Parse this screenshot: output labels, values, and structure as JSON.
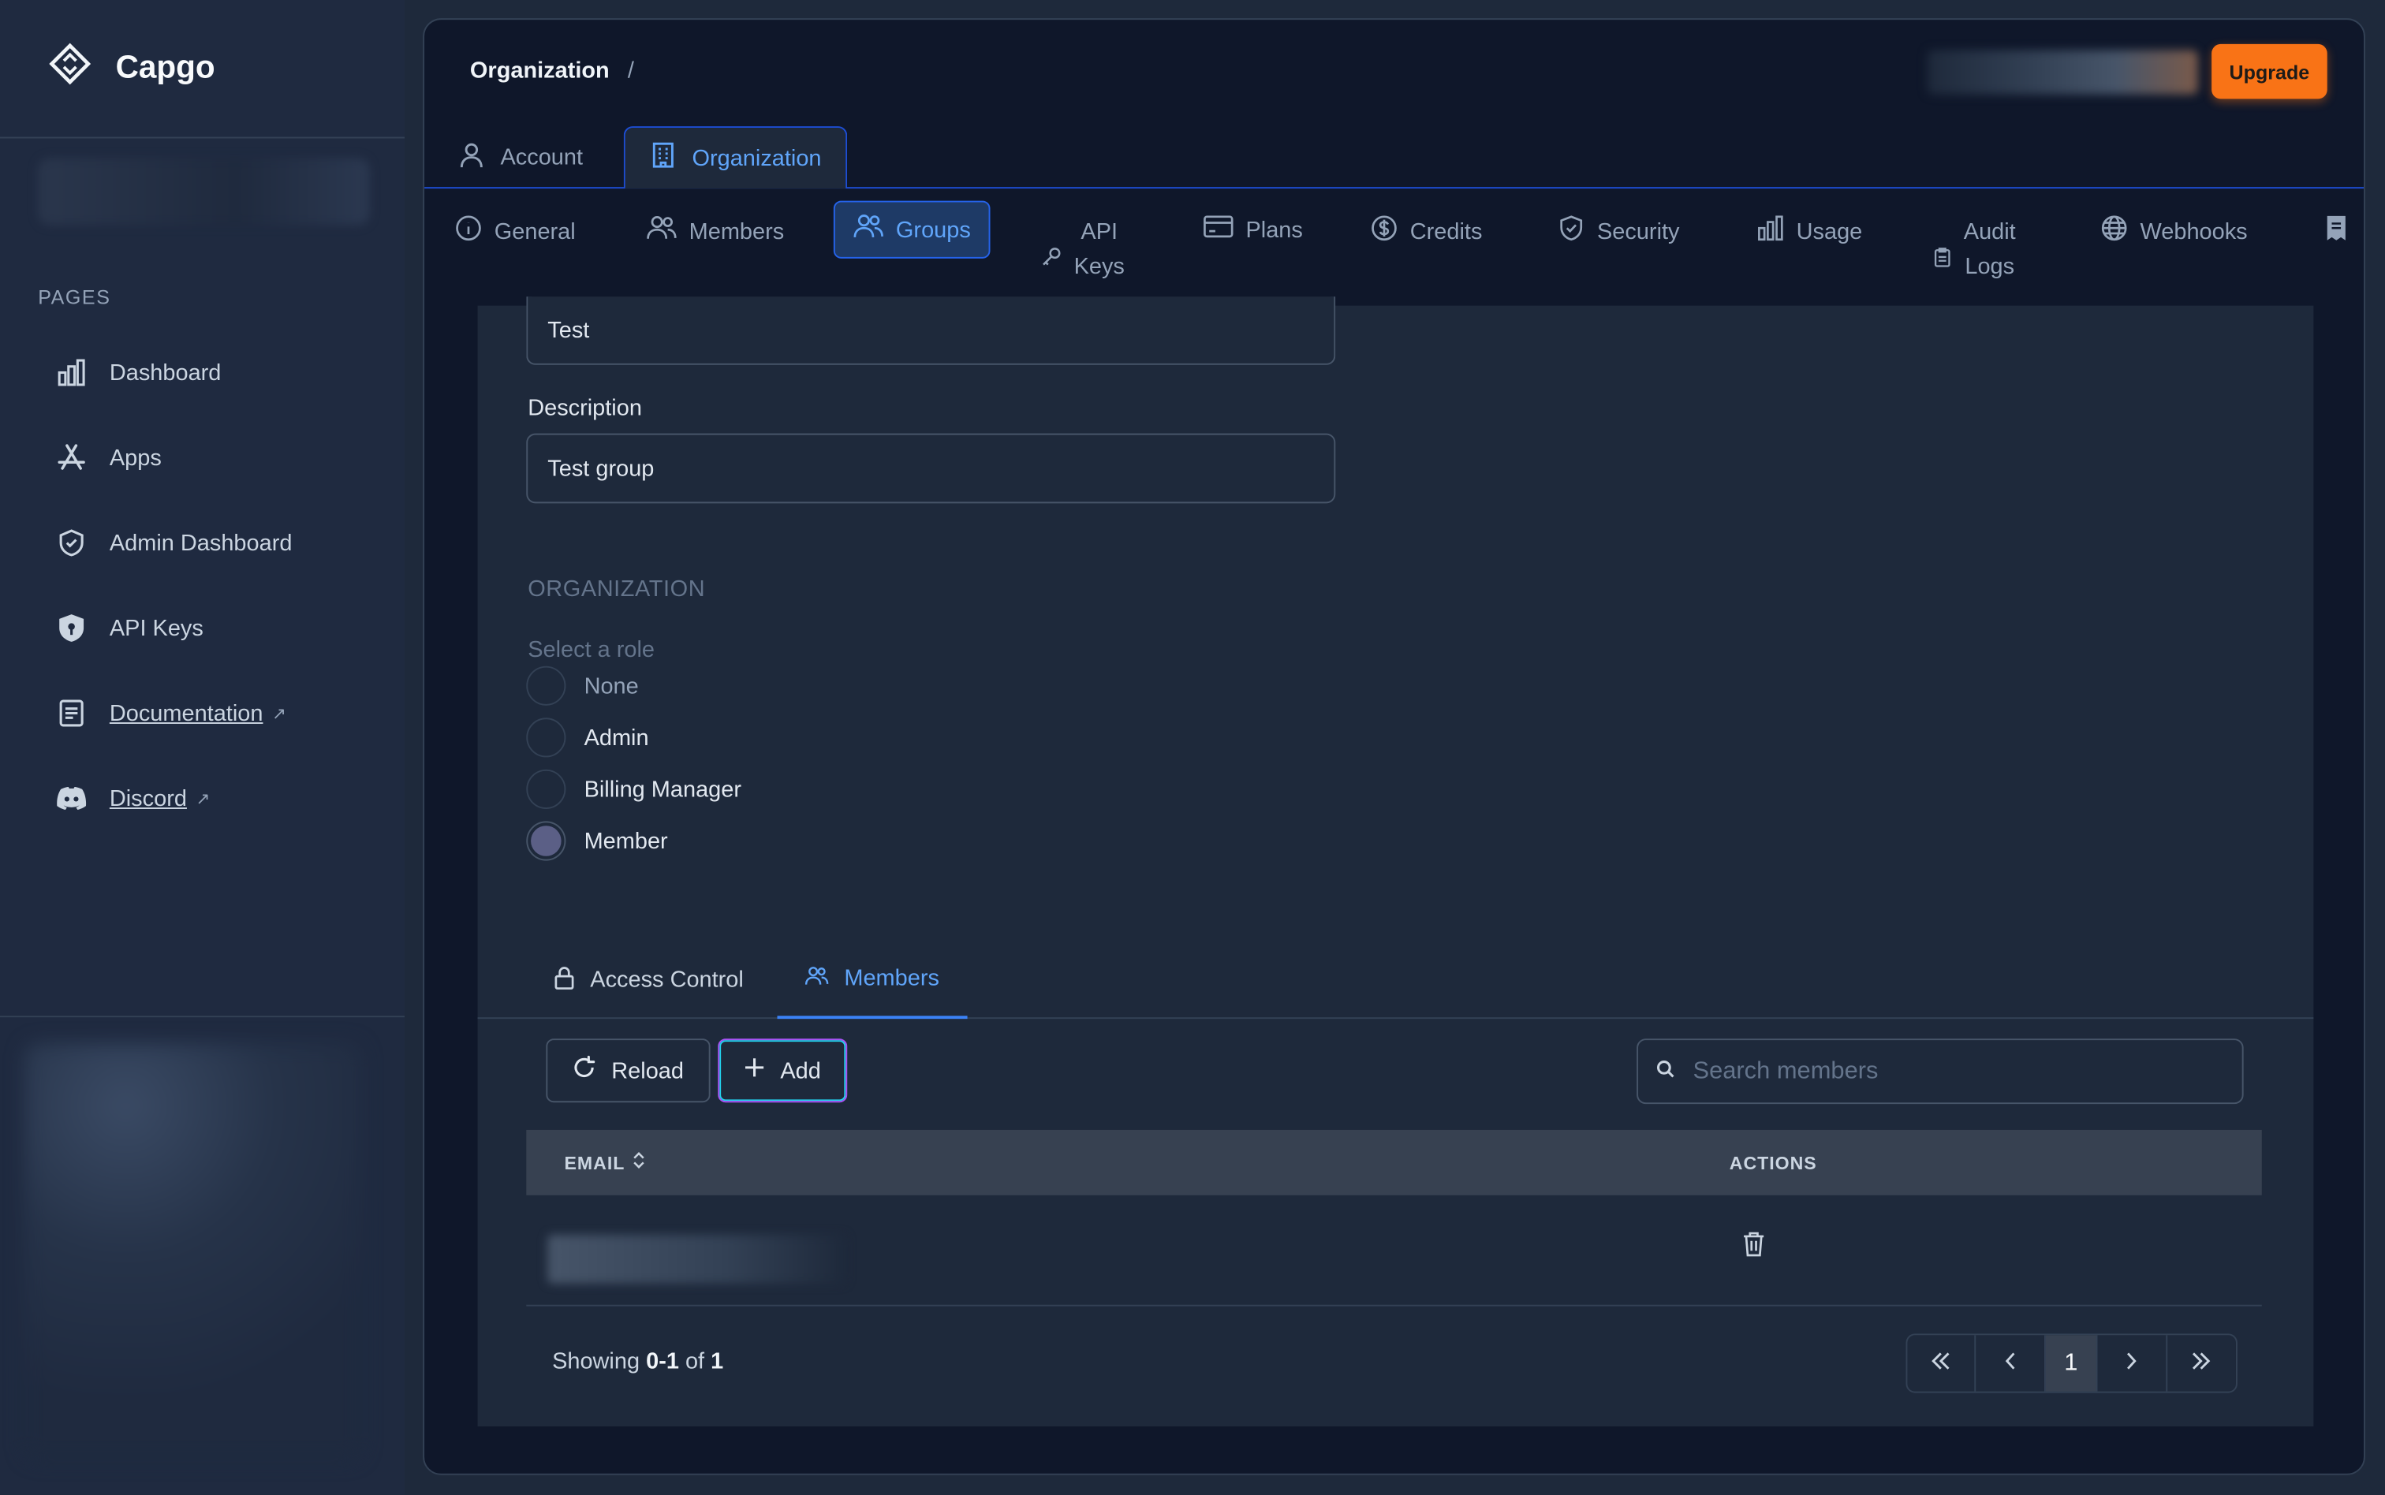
{
  "brand": {
    "name": "Capgo"
  },
  "sidebar": {
    "section_title": "PAGES",
    "items": [
      {
        "label": "Dashboard",
        "icon": "bar-chart-icon"
      },
      {
        "label": "Apps",
        "icon": "app-store-icon"
      },
      {
        "label": "Admin Dashboard",
        "icon": "shield-check-icon"
      },
      {
        "label": "API Keys",
        "icon": "shield-key-icon"
      },
      {
        "label": "Documentation",
        "icon": "document-icon",
        "external": true
      },
      {
        "label": "Discord",
        "icon": "discord-icon",
        "external": true
      }
    ]
  },
  "header": {
    "breadcrumb": "Organization",
    "breadcrumb_sep": "/",
    "upgrade_label": "Upgrade"
  },
  "top_tabs": [
    {
      "label": "Account",
      "active": false
    },
    {
      "label": "Organization",
      "active": true
    }
  ],
  "sub_tabs": [
    {
      "label": "General"
    },
    {
      "label": "Members"
    },
    {
      "label": "Groups",
      "active": true
    },
    {
      "label_line1": "API",
      "label_line2": "Keys"
    },
    {
      "label": "Plans"
    },
    {
      "label": "Credits"
    },
    {
      "label": "Security"
    },
    {
      "label": "Usage"
    },
    {
      "label_line1": "Audit",
      "label_line2": "Logs"
    },
    {
      "label": "Webhooks"
    }
  ],
  "form": {
    "name_value": "Test",
    "description_label": "Description",
    "description_value": "Test group",
    "section_title": "ORGANIZATION",
    "role_prompt": "Select a role",
    "roles": [
      {
        "label": "None",
        "checked": false
      },
      {
        "label": "Admin",
        "checked": false
      },
      {
        "label": "Billing Manager",
        "checked": false
      },
      {
        "label": "Member",
        "checked": true
      }
    ]
  },
  "inner_tabs": [
    {
      "label": "Access Control",
      "active": false
    },
    {
      "label": "Members",
      "active": true
    }
  ],
  "toolbar": {
    "reload_label": "Reload",
    "add_label": "Add",
    "search_placeholder": "Search members"
  },
  "table": {
    "columns": [
      "EMAIL",
      "ACTIONS"
    ]
  },
  "footer": {
    "showing_prefix": "Showing",
    "showing_range": "0-1",
    "showing_of": "of",
    "showing_total": "1",
    "current_page": "1"
  },
  "colors": {
    "accent": "#60a5fa",
    "upgrade": "#f97316",
    "sidebar_bg": "#1f2a40",
    "main_bg": "#0f172a"
  }
}
